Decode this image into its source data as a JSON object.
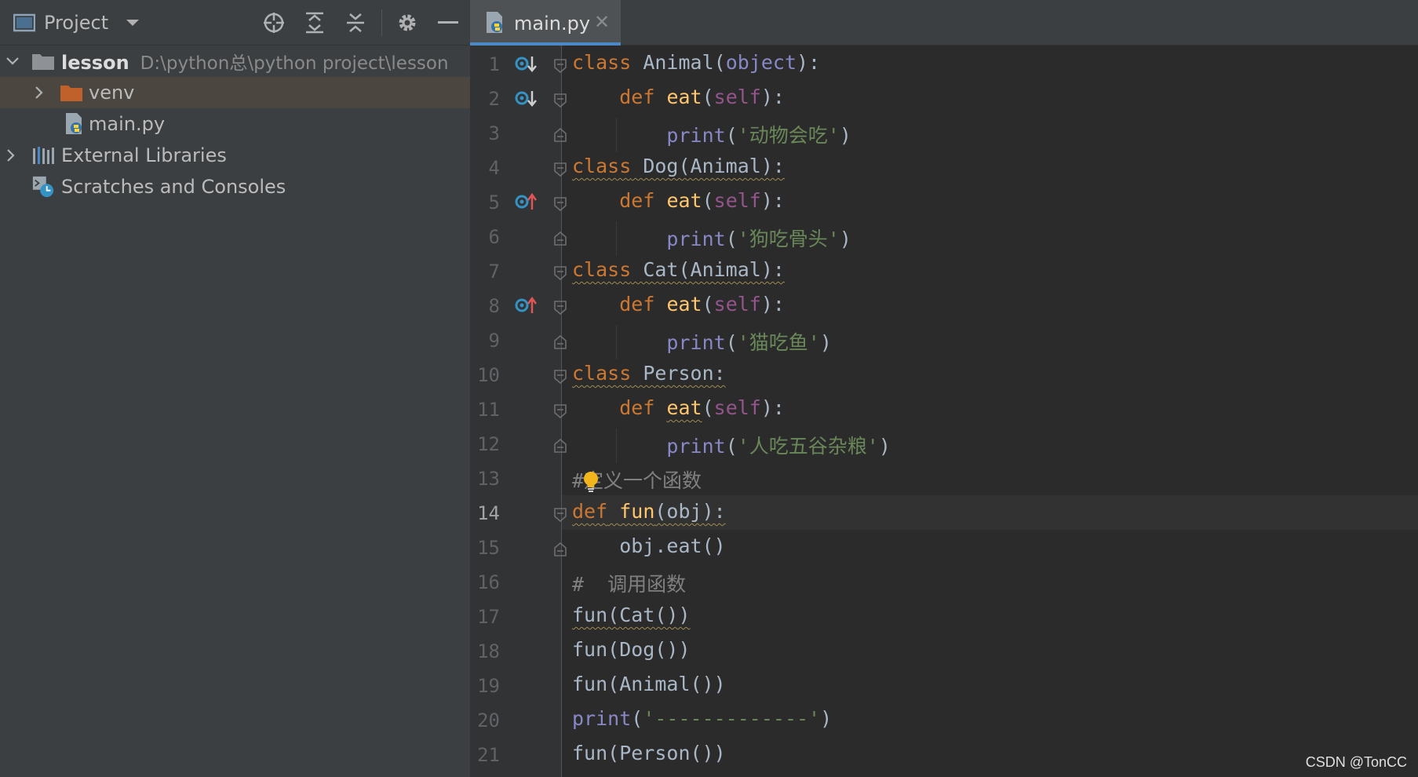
{
  "project_panel": {
    "title": "Project",
    "tree": [
      {
        "label": "lesson",
        "path": "D:\\python总\\python project\\lesson"
      },
      {
        "label": "venv"
      },
      {
        "label": "main.py"
      },
      {
        "label": "External Libraries"
      },
      {
        "label": "Scratches and Consoles"
      }
    ]
  },
  "editor": {
    "tab_label": "main.py",
    "close_glyph": "✕",
    "current_line": 14,
    "lines": [
      {
        "no": "1",
        "segments": [
          {
            "t": "class",
            "c": "kw"
          },
          {
            "t": " Animal(",
            "c": ""
          },
          {
            "t": "object",
            "c": "bi"
          },
          {
            "t": "):",
            "c": ""
          }
        ]
      },
      {
        "no": "2",
        "segments": [
          {
            "t": "    ",
            "c": ""
          },
          {
            "t": "def",
            "c": "kw"
          },
          {
            "t": " ",
            "c": ""
          },
          {
            "t": "eat",
            "c": "fn"
          },
          {
            "t": "(",
            "c": ""
          },
          {
            "t": "self",
            "c": "self"
          },
          {
            "t": "):",
            "c": ""
          }
        ]
      },
      {
        "no": "3",
        "segments": [
          {
            "t": "        ",
            "c": ""
          },
          {
            "t": "print",
            "c": "bi"
          },
          {
            "t": "(",
            "c": ""
          },
          {
            "t": "'动物会吃'",
            "c": "str"
          },
          {
            "t": ")",
            "c": ""
          }
        ]
      },
      {
        "no": "4",
        "segments": [
          {
            "t": "class",
            "c": "kw squig"
          },
          {
            "t": " Dog(Animal):",
            "c": "squig"
          }
        ]
      },
      {
        "no": "5",
        "segments": [
          {
            "t": "    ",
            "c": ""
          },
          {
            "t": "def",
            "c": "kw"
          },
          {
            "t": " ",
            "c": ""
          },
          {
            "t": "eat",
            "c": "fn"
          },
          {
            "t": "(",
            "c": ""
          },
          {
            "t": "self",
            "c": "self"
          },
          {
            "t": "):",
            "c": ""
          }
        ]
      },
      {
        "no": "6",
        "segments": [
          {
            "t": "        ",
            "c": ""
          },
          {
            "t": "print",
            "c": "bi"
          },
          {
            "t": "(",
            "c": ""
          },
          {
            "t": "'狗吃骨头'",
            "c": "str"
          },
          {
            "t": ")",
            "c": ""
          }
        ]
      },
      {
        "no": "7",
        "segments": [
          {
            "t": "class",
            "c": "kw squig"
          },
          {
            "t": " Cat(Animal):",
            "c": "squig"
          }
        ]
      },
      {
        "no": "8",
        "segments": [
          {
            "t": "    ",
            "c": ""
          },
          {
            "t": "def",
            "c": "kw"
          },
          {
            "t": " ",
            "c": ""
          },
          {
            "t": "eat",
            "c": "fn"
          },
          {
            "t": "(",
            "c": ""
          },
          {
            "t": "self",
            "c": "self"
          },
          {
            "t": "):",
            "c": ""
          }
        ]
      },
      {
        "no": "9",
        "segments": [
          {
            "t": "        ",
            "c": ""
          },
          {
            "t": "print",
            "c": "bi"
          },
          {
            "t": "(",
            "c": ""
          },
          {
            "t": "'猫吃鱼'",
            "c": "str"
          },
          {
            "t": ")",
            "c": ""
          }
        ]
      },
      {
        "no": "10",
        "segments": [
          {
            "t": "class",
            "c": "kw squig"
          },
          {
            "t": " Person:",
            "c": "squig"
          }
        ]
      },
      {
        "no": "11",
        "segments": [
          {
            "t": "    ",
            "c": ""
          },
          {
            "t": "def",
            "c": "kw"
          },
          {
            "t": " ",
            "c": ""
          },
          {
            "t": "eat",
            "c": "fn squig"
          },
          {
            "t": "(",
            "c": ""
          },
          {
            "t": "self",
            "c": "self"
          },
          {
            "t": "):",
            "c": ""
          }
        ]
      },
      {
        "no": "12",
        "segments": [
          {
            "t": "        ",
            "c": ""
          },
          {
            "t": "print",
            "c": "bi"
          },
          {
            "t": "(",
            "c": ""
          },
          {
            "t": "'人吃五谷杂粮'",
            "c": "str"
          },
          {
            "t": ")",
            "c": ""
          }
        ]
      },
      {
        "no": "13",
        "segments": [
          {
            "t": "#定义一个函数",
            "c": "cmt"
          }
        ]
      },
      {
        "no": "14",
        "segments": [
          {
            "t": "def",
            "c": "kw squig"
          },
          {
            "t": " ",
            "c": "squig"
          },
          {
            "t": "fun",
            "c": "fn squig"
          },
          {
            "t": "(obj):",
            "c": "squig"
          }
        ]
      },
      {
        "no": "15",
        "segments": [
          {
            "t": "    obj.eat()",
            "c": ""
          }
        ]
      },
      {
        "no": "16",
        "segments": [
          {
            "t": "#  调用函数",
            "c": "cmt"
          }
        ]
      },
      {
        "no": "17",
        "segments": [
          {
            "t": "fun(Cat())",
            "c": "squig"
          }
        ]
      },
      {
        "no": "18",
        "segments": [
          {
            "t": "fun(Dog())",
            "c": ""
          }
        ]
      },
      {
        "no": "19",
        "segments": [
          {
            "t": "fun(Animal())",
            "c": ""
          }
        ]
      },
      {
        "no": "20",
        "segments": [
          {
            "t": "print",
            "c": "bi"
          },
          {
            "t": "(",
            "c": ""
          },
          {
            "t": "'-------------'",
            "c": "str"
          },
          {
            "t": ")",
            "c": ""
          }
        ]
      },
      {
        "no": "21",
        "segments": [
          {
            "t": "fun(Person())",
            "c": ""
          }
        ]
      }
    ]
  },
  "watermark": "CSDN @TonCC",
  "colors": {
    "keyword": "#cc7832",
    "function": "#ffc66d",
    "self": "#94558d",
    "string": "#6a8759",
    "builtin": "#8888c6",
    "comment": "#808080",
    "tab_underline": "#4a88c7",
    "folder": "#c0612b"
  }
}
